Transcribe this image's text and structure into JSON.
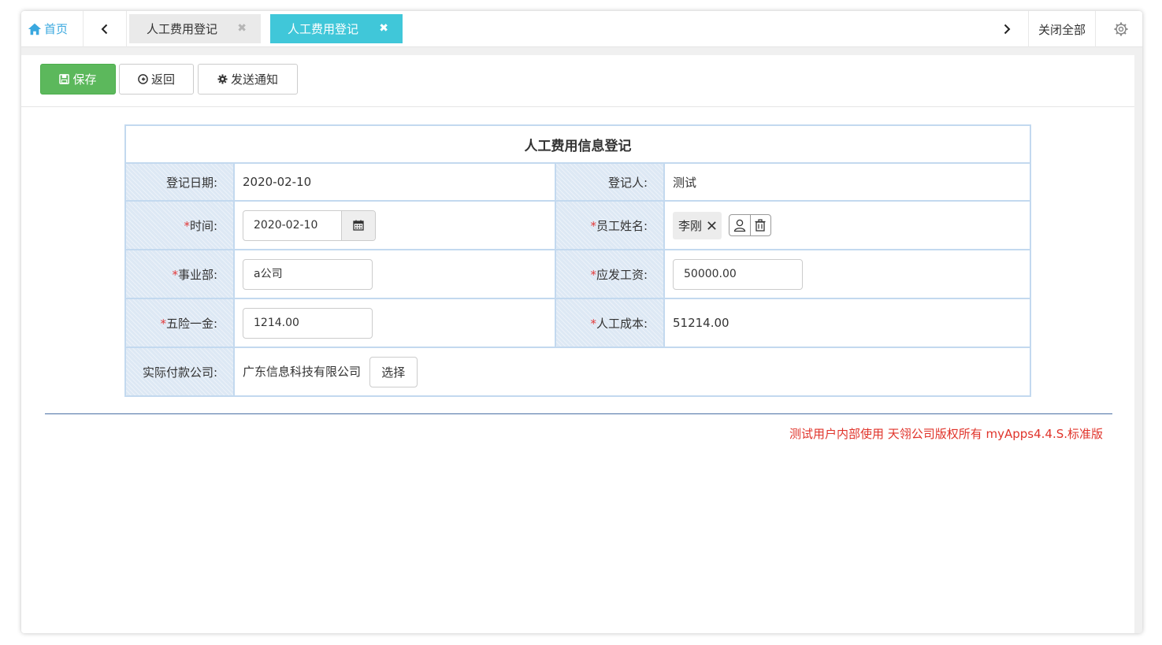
{
  "tabbar": {
    "home_label": "首页",
    "tabs": [
      {
        "label": "人工费用登记",
        "active": false
      },
      {
        "label": "人工费用登记",
        "active": true
      }
    ],
    "close_all_label": "关闭全部"
  },
  "toolbar": {
    "save_label": "保存",
    "back_label": "返回",
    "notify_label": "发送通知",
    "save_color": "#5cb85c"
  },
  "form": {
    "title": "人工费用信息登记",
    "fields": {
      "reg_date": {
        "label": "登记日期:",
        "value": "2020-02-10"
      },
      "registrant": {
        "label": "登记人:",
        "value": "测试"
      },
      "time": {
        "label": "时间:",
        "value": "2020-02-10",
        "required": true
      },
      "employee": {
        "label": "员工姓名:",
        "value": "李刚",
        "required": true
      },
      "division": {
        "label": "事业部:",
        "value": "a公司",
        "required": true
      },
      "salary": {
        "label": "应发工资:",
        "value": "50000.00",
        "required": true
      },
      "insurance": {
        "label": "五险一金:",
        "value": "1214.00",
        "required": true
      },
      "labor_cost": {
        "label": "人工成本:",
        "value": "51214.00",
        "required": true
      },
      "payer": {
        "label": "实际付款公司:",
        "value": "广东信息科技有限公司",
        "button_label": "选择"
      }
    },
    "required_mark": "*"
  },
  "footer": {
    "text": "测试用户内部使用 天翎公司版权所有 myApps4.4.S.标准版",
    "color": "#e0332a"
  },
  "icons": {
    "home": "home-icon",
    "prev": "chevron-left-icon",
    "next": "chevron-right-icon",
    "settings": "gear-icon",
    "save": "floppy-icon",
    "back": "circle-arrow-left-icon",
    "notify": "cog-icon",
    "calendar": "calendar-icon",
    "remove": "close-icon",
    "user_picker": "user-icon",
    "clear": "trash-icon"
  }
}
